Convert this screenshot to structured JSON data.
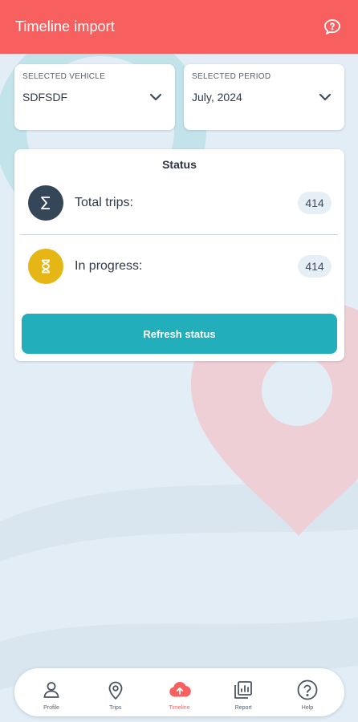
{
  "app_bar": {
    "title": "Timeline import",
    "help_icon": "chat-question-icon"
  },
  "vehicle_selector": {
    "caption": "SELECTED VEHICLE",
    "value": "SDFSDF",
    "icon": "chevron-down-icon"
  },
  "period_selector": {
    "caption": "SELECTED PERIOD",
    "value": "July, 2024",
    "icon": "chevron-down-icon"
  },
  "status": {
    "title": "Status",
    "total_trips": {
      "label": "Total trips:",
      "value": "414",
      "icon": "sigma-icon"
    },
    "in_progress": {
      "label": "In progress:",
      "value": "414",
      "icon": "hourglass-icon"
    },
    "refresh_label": "Refresh status"
  },
  "bottom_nav": {
    "items": [
      {
        "label": "Profile",
        "icon": "person-icon"
      },
      {
        "label": "Trips",
        "icon": "map-pin-icon"
      },
      {
        "label": "Timeline",
        "icon": "cloud-upload-icon",
        "active": true
      },
      {
        "label": "Report",
        "icon": "report-icon"
      },
      {
        "label": "Help",
        "icon": "help-circle-icon"
      }
    ]
  },
  "colors": {
    "app_bar": "#f7605f",
    "accent_teal": "#23aebc",
    "sigma_bg": "#354659",
    "hourglass_bg": "#e5b614",
    "background": "#e3edf6"
  }
}
